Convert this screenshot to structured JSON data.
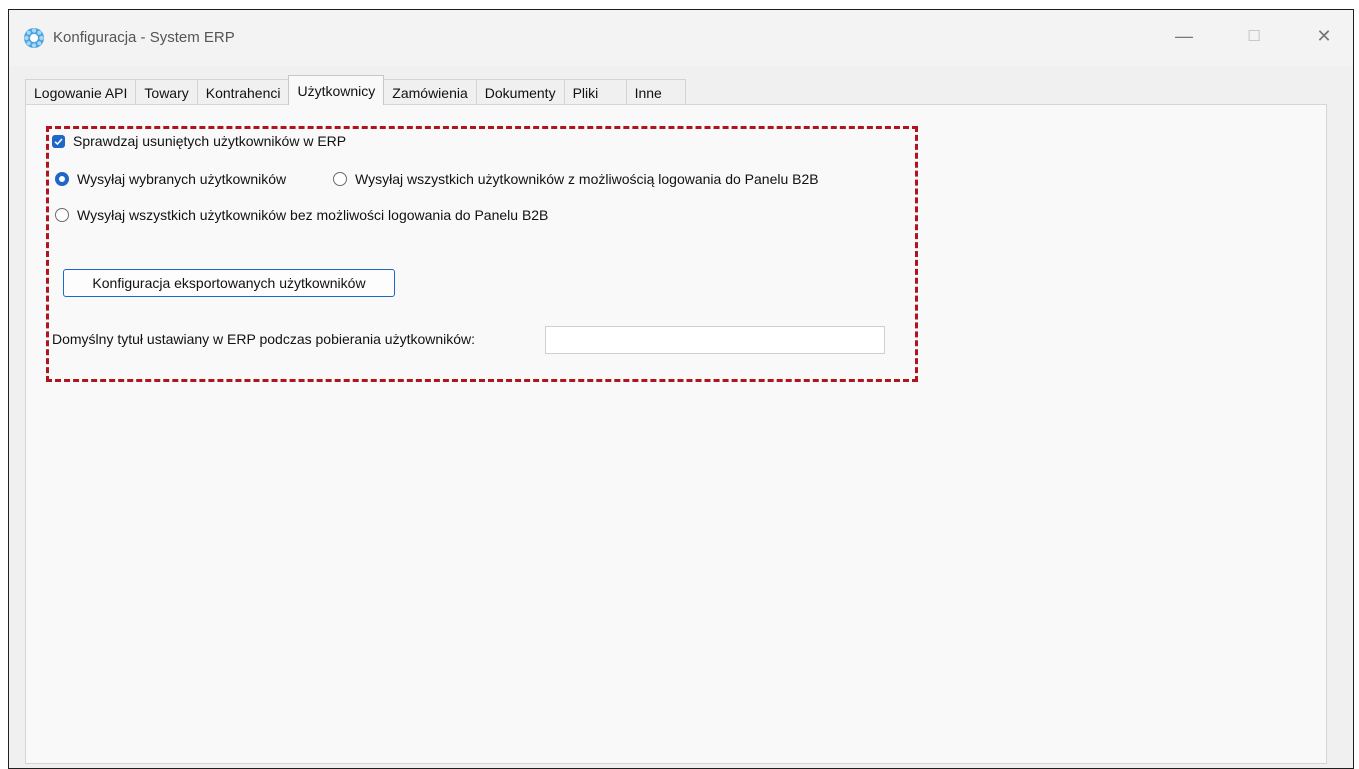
{
  "window": {
    "title": "Konfiguracja - System ERP",
    "minimize_symbol": "—",
    "maximize_symbol": "☐",
    "close_symbol": "✕"
  },
  "tabs": [
    {
      "label": "Logowanie API"
    },
    {
      "label": "Towary"
    },
    {
      "label": "Kontrahenci"
    },
    {
      "label": "Użytkownicy",
      "active": true
    },
    {
      "label": "Zamówienia"
    },
    {
      "label": "Dokumenty"
    },
    {
      "label": "Pliki"
    },
    {
      "label": "Inne"
    }
  ],
  "settings": {
    "check_deleted": {
      "label": "Sprawdzaj usuniętych użytkowników w ERP",
      "checked": true
    },
    "radio_selected": {
      "label": "Wysyłaj wybranych użytkowników",
      "checked": true
    },
    "radio_all_login": {
      "label": "Wysyłaj wszystkich użytkowników z możliwością logowania do Panelu B2B",
      "checked": false
    },
    "radio_all_nologin": {
      "label": "Wysyłaj wszystkich użytkowników bez możliwości logowania do Panelu B2B",
      "checked": false
    },
    "config_button": "Konfiguracja eksportowanych użytkowników",
    "default_title_label": "Domyślny tytuł ustawiany w ERP podczas pobierania użytkowników:",
    "default_title_value": ""
  },
  "colors": {
    "accent": "#1e67c8",
    "highlight_border": "#b0151f"
  }
}
